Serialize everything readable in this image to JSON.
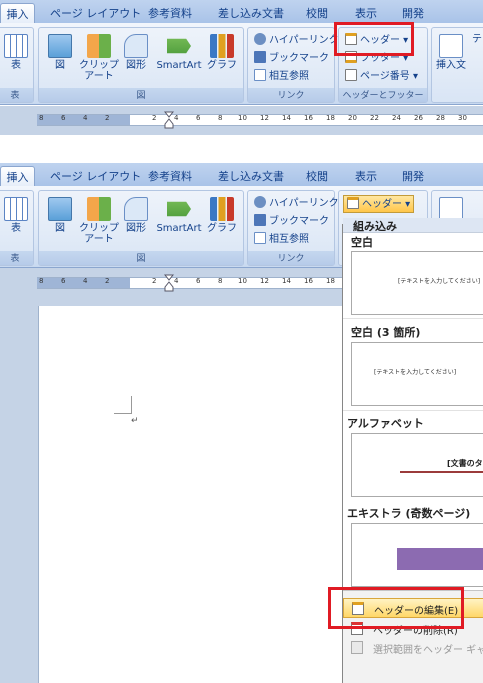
{
  "tabs": [
    "挿入",
    "ページ レイアウト",
    "参考資料",
    "差し込み文書",
    "校閲",
    "表示",
    "開発"
  ],
  "groups": {
    "table": {
      "button": "表",
      "label": "表"
    },
    "illust": {
      "buttons": [
        "図",
        "クリップ\nアート",
        "図形",
        "SmartArt",
        "グラフ"
      ],
      "label": "図"
    },
    "links": {
      "buttons": [
        "ハイパーリンク",
        "ブックマーク",
        "相互参照"
      ],
      "label": "リンク"
    },
    "header_footer": {
      "buttons": [
        "ヘッダー",
        "フッター",
        "ページ番号"
      ],
      "label": "ヘッダーとフッター"
    },
    "text": {
      "button": "挿入文",
      "button2": "テ"
    }
  },
  "ruler": {
    "numbers": [
      "8",
      "6",
      "4",
      "2",
      "2",
      "4",
      "6",
      "8",
      "10",
      "12",
      "14",
      "16",
      "18",
      "20",
      "22",
      "24",
      "26",
      "28",
      "30"
    ]
  },
  "dropdown": {
    "category": "組み込み",
    "items": [
      {
        "title": "空白",
        "preview": "[テキストを入力してください]"
      },
      {
        "title": "空白 (3 箇所)",
        "preview": "[テキストを入力してください]"
      },
      {
        "title": "アルファベット",
        "preview": "[文書のタ"
      },
      {
        "title": "エキストラ (奇数ページ)",
        "preview": ""
      }
    ],
    "menu": [
      "ヘッダーの編集(E)",
      "ヘッダーの削除(R)",
      "選択範囲をヘッダー ギャラ"
    ]
  },
  "doc": {
    "mark": "↵"
  }
}
